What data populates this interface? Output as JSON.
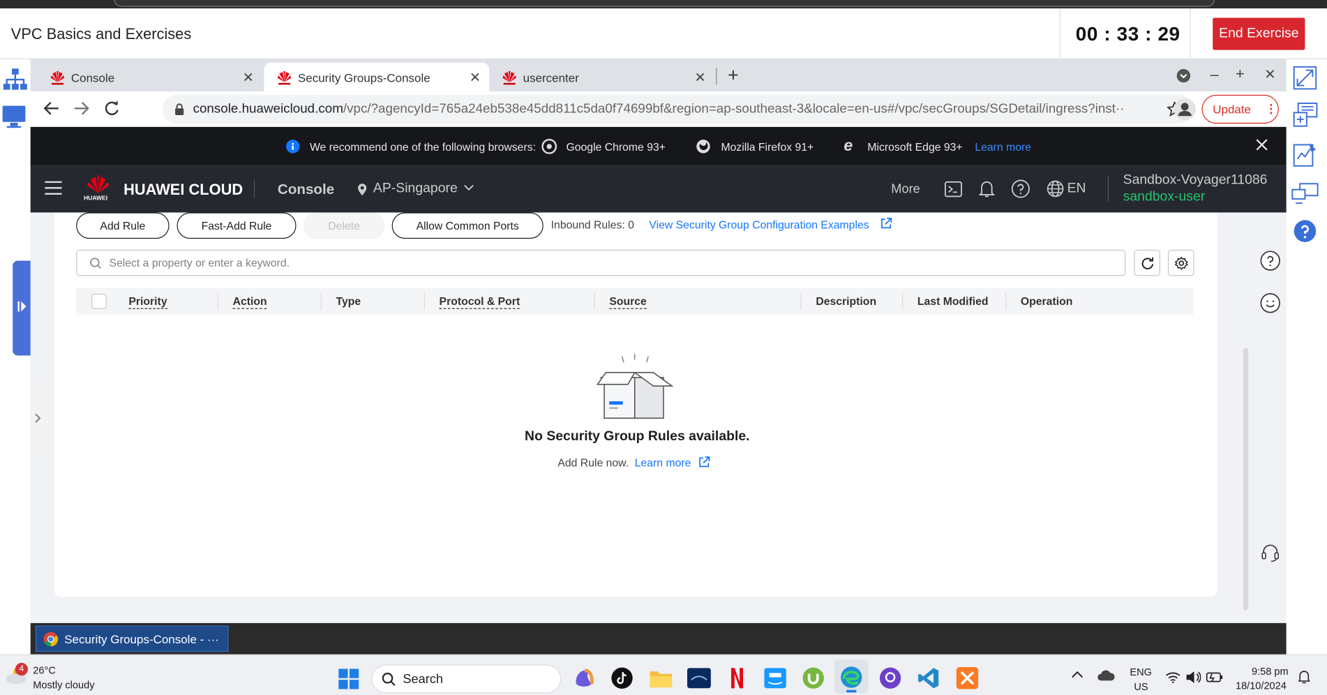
{
  "lab": {
    "title": "VPC Basics and Exercises",
    "timer": "00 : 33 : 29",
    "end_button": "End Exercise"
  },
  "browser": {
    "tabs": [
      {
        "label": "Console",
        "active": false
      },
      {
        "label": "Security Groups-Console",
        "active": true
      },
      {
        "label": "usercenter",
        "active": false
      }
    ],
    "url": {
      "host": "console.huaweicloud.com",
      "path": "/vpc/?agencyId=765a24eb538e45dd811c5da0f74699bf&region=ap-southeast-3&locale=en-us#/vpc/secGroups/SGDetail/ingress?inst···"
    },
    "update_button": "Update"
  },
  "notice": {
    "text": "We recommend one of the following browsers:",
    "chrome": "Google Chrome 93+",
    "firefox": "Mozilla Firefox 91+",
    "edge": "Microsoft Edge 93+",
    "learn_more": "Learn more"
  },
  "nav": {
    "brand": "HUAWEI CLOUD",
    "logo_text": "HUAWEI",
    "console": "Console",
    "region": "AP-Singapore",
    "more": "More",
    "language": "EN",
    "account": "Sandbox-Voyager11086",
    "user": "sandbox-user"
  },
  "toolbar": {
    "add_rule": "Add Rule",
    "fast_add_rule": "Fast-Add Rule",
    "delete": "Delete",
    "allow_common_ports": "Allow Common Ports",
    "inbound_rules": "Inbound Rules: 0",
    "examples_link": "View Security Group Configuration Examples"
  },
  "search": {
    "placeholder": "Select a property or enter a keyword."
  },
  "table": {
    "columns": [
      "Priority",
      "Action",
      "Type",
      "Protocol & Port",
      "Source",
      "Description",
      "Last Modified",
      "Operation"
    ]
  },
  "empty": {
    "title": "No Security Group Rules available.",
    "text": "Add Rule now.",
    "link": "Learn more"
  },
  "task_item": "Security Groups-Console - ···",
  "weather": {
    "badge": "4",
    "temp": "26°C",
    "desc": "Mostly cloudy"
  },
  "taskbar": {
    "search": "Search",
    "lang_top": "ENG",
    "lang_bottom": "US",
    "time": "9:58 pm",
    "date": "18/10/2024"
  },
  "colors": {
    "end_button": "#d8262e",
    "huawei_red": "#e60012",
    "link_blue": "#1476ff",
    "user_green": "#27c26c",
    "nav_bg": "#262830"
  }
}
